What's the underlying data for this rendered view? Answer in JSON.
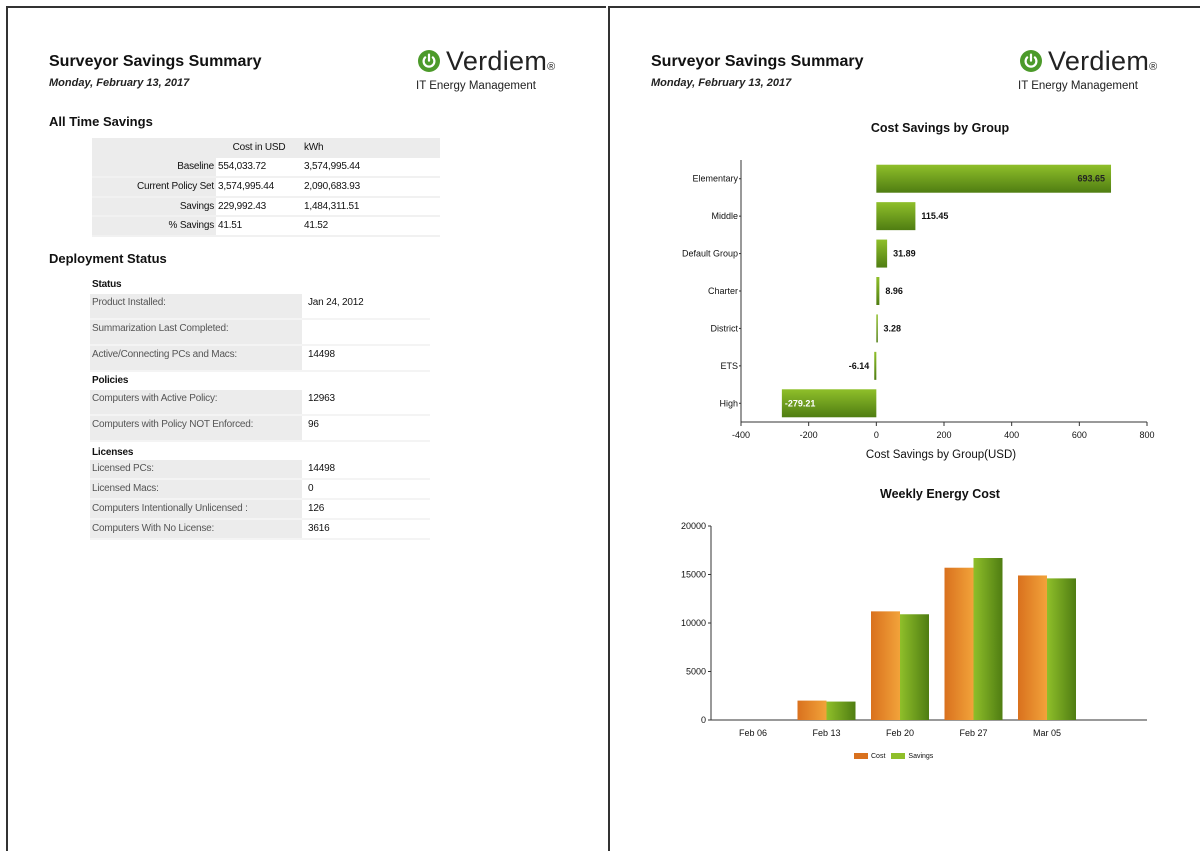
{
  "report": {
    "title": "Surveyor Savings Summary",
    "date": "Monday, February 13, 2017",
    "logo_brand": "Verdiem",
    "logo_reg": "®",
    "logo_tagline": "IT Energy Management"
  },
  "all_time": {
    "title": "All Time Savings",
    "col_cost": "Cost in USD",
    "col_kwh": "kWh",
    "rows": [
      {
        "label": "Baseline",
        "cost": "554,033.72",
        "kwh": "3,574,995.44"
      },
      {
        "label": "Current Policy Set",
        "cost": "3,574,995.44",
        "kwh": "2,090,683.93"
      },
      {
        "label": "Savings",
        "cost": "229,992.43",
        "kwh": "1,484,311.51"
      },
      {
        "label": "% Savings",
        "cost": "41.51",
        "kwh": "41.52"
      }
    ]
  },
  "deployment": {
    "title": "Deployment Status",
    "status": {
      "title": "Status",
      "rows": [
        {
          "label": "Product Installed:",
          "value": "Jan 24, 2012"
        },
        {
          "label": "Summarization Last Completed:",
          "value": ""
        },
        {
          "label": "Active/Connecting PCs and Macs:",
          "value": "14498"
        }
      ]
    },
    "policies": {
      "title": "Policies",
      "rows": [
        {
          "label": "Computers with Active Policy:",
          "value": "12963"
        },
        {
          "label": "Computers with Policy NOT Enforced:",
          "value": "96"
        }
      ]
    },
    "licenses": {
      "title": "Licenses",
      "rows": [
        {
          "label": "Licensed PCs:",
          "value": "14498"
        },
        {
          "label": "Licensed Macs:",
          "value": "0"
        },
        {
          "label": "Computers Intentionally Unlicensed :",
          "value": "126"
        },
        {
          "label": "Computers With No License:",
          "value": "3616"
        }
      ]
    }
  },
  "colors": {
    "green_dark": "#4f7d12",
    "green_light": "#8fbf2a",
    "orange_dark": "#d9711e",
    "orange_light": "#f2a33a"
  },
  "chart_data": [
    {
      "type": "bar",
      "orientation": "horizontal",
      "title": "Cost Savings by Group",
      "xlabel": "Cost Savings by Group(USD)",
      "categories": [
        "Elementary",
        "Middle",
        "Default Group",
        "Charter",
        "District",
        "ETS",
        "High"
      ],
      "values": [
        693.65,
        115.45,
        31.89,
        8.96,
        3.28,
        -6.14,
        -279.21
      ],
      "data_labels": [
        "693.65",
        "115.45",
        "31.89",
        "8.96",
        "3.28",
        "-6.14",
        "-279.21"
      ],
      "xlim": [
        -400,
        800
      ],
      "xticks": [
        -400,
        -200,
        0,
        200,
        400,
        600,
        800
      ],
      "grid": false
    },
    {
      "type": "bar",
      "title": "Weekly Energy Cost",
      "categories": [
        "Feb 06",
        "Feb 13",
        "Feb 20",
        "Feb 27",
        "Mar 05"
      ],
      "series": [
        {
          "name": "Cost",
          "values": [
            0,
            2000,
            11200,
            15700,
            14900
          ]
        },
        {
          "name": "Savings",
          "values": [
            0,
            1900,
            10900,
            16700,
            14600
          ]
        }
      ],
      "ylim": [
        0,
        20000
      ],
      "yticks": [
        0,
        5000,
        10000,
        15000,
        20000
      ],
      "legend": "bottom",
      "grid": false
    }
  ]
}
